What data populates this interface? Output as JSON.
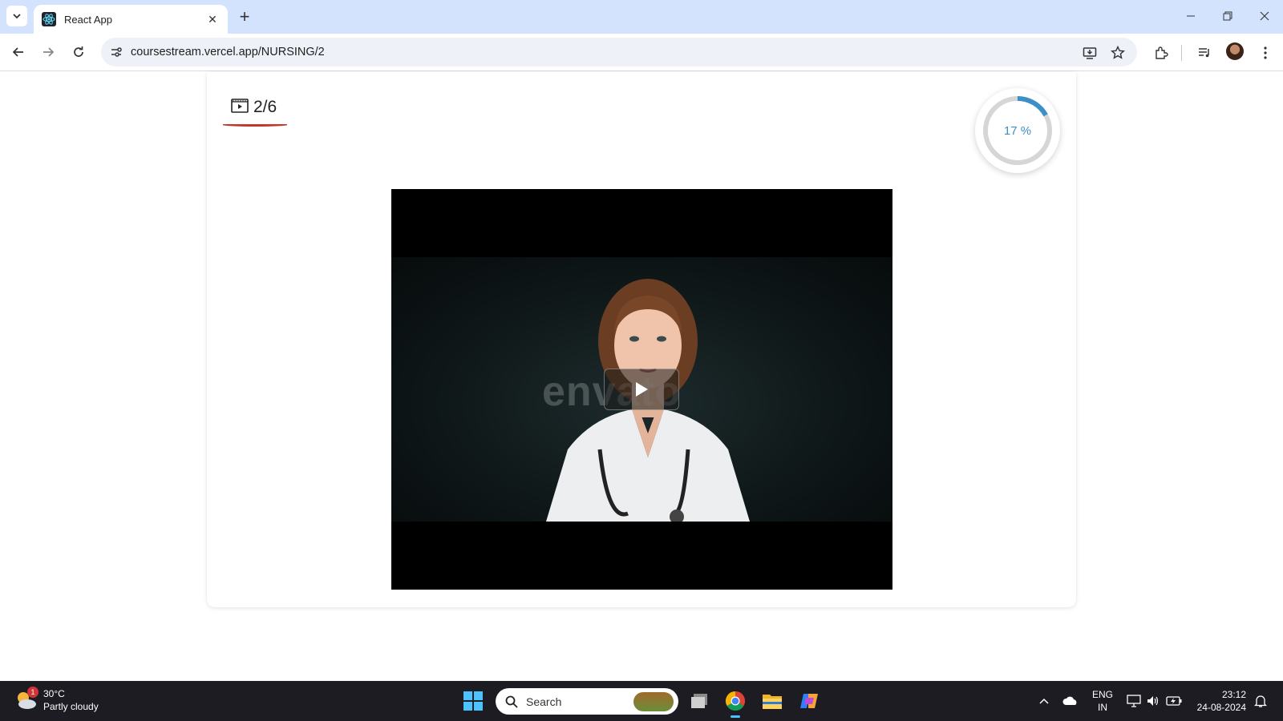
{
  "browser": {
    "tab": {
      "title": "React App",
      "icon": "react-logo-icon"
    },
    "url": "coursestream.vercel.app/NURSING/2"
  },
  "lesson": {
    "counter": "2/6",
    "counter_icon": "video-lesson-icon",
    "accent_color": "#c0392b"
  },
  "progress": {
    "label": "17 %",
    "value": 0.17,
    "color": "#3d8fc7"
  },
  "video": {
    "watermark": "envato",
    "play_icon": "play-icon"
  },
  "taskbar": {
    "weather": {
      "temp": "30°C",
      "condition": "Partly cloudy",
      "badge": "1"
    },
    "search_placeholder": "Search",
    "language": {
      "line1": "ENG",
      "line2": "IN"
    },
    "time": "23:12",
    "date": "24-08-2024"
  }
}
